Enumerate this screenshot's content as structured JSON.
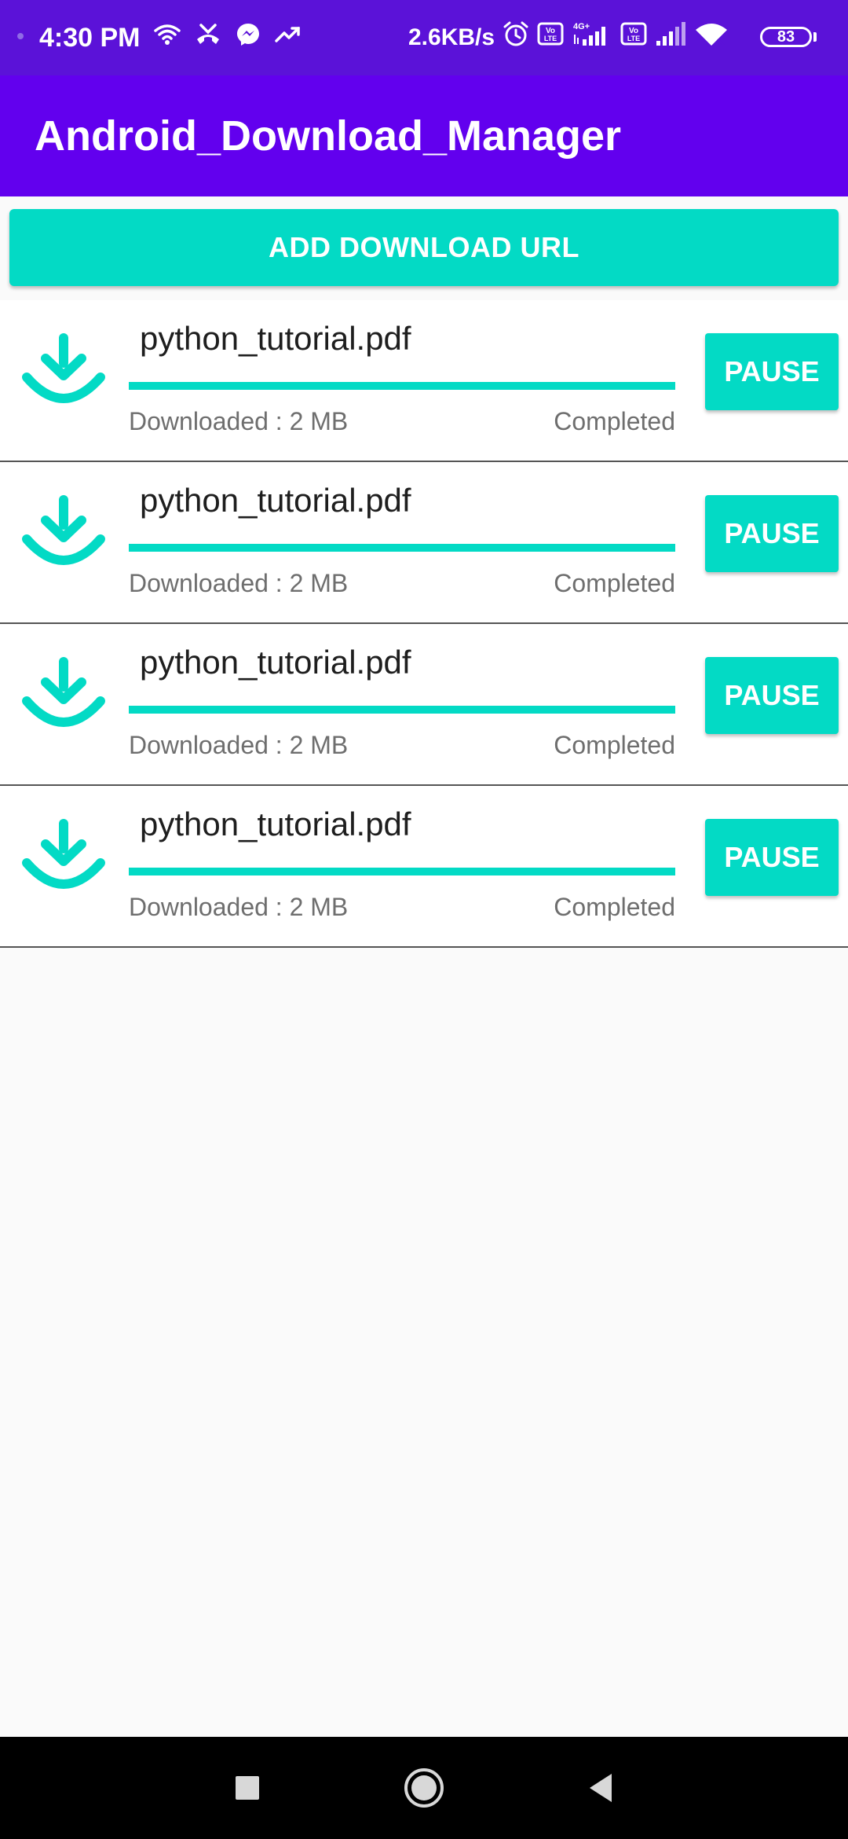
{
  "status_bar": {
    "time": "4:30 PM",
    "net_speed": "2.6KB/s",
    "battery": "83",
    "volte_label_1": "Vo\nLTE",
    "volte_label_2": "Vo\nLTE",
    "network_type": "4G+",
    "icons": [
      "wifi-icon",
      "missed-call-icon",
      "messenger-icon",
      "trending-icon",
      "alarm-icon",
      "volte-icon",
      "signal-icon",
      "volte-icon",
      "signal-icon",
      "wifi-icon",
      "battery-icon"
    ]
  },
  "app_bar": {
    "title": "Android_Download_Manager"
  },
  "add_button": {
    "label": "ADD DOWNLOAD URL"
  },
  "downloads": [
    {
      "file_name": "python_tutorial.pdf",
      "downloaded": "Downloaded : 2 MB",
      "status": "Completed",
      "progress": 1.0,
      "action_label": "PAUSE",
      "icon": "download-icon"
    },
    {
      "file_name": "python_tutorial.pdf",
      "downloaded": "Downloaded : 2 MB",
      "status": "Completed",
      "progress": 1.0,
      "action_label": "PAUSE",
      "icon": "download-icon"
    },
    {
      "file_name": "python_tutorial.pdf",
      "downloaded": "Downloaded : 2 MB",
      "status": "Completed",
      "progress": 1.0,
      "action_label": "PAUSE",
      "icon": "download-icon"
    },
    {
      "file_name": "python_tutorial.pdf",
      "downloaded": "Downloaded : 2 MB",
      "status": "Completed",
      "progress": 1.0,
      "action_label": "PAUSE",
      "icon": "download-icon"
    }
  ],
  "nav_bar": {
    "icons": [
      "recents-square-icon",
      "home-circle-icon",
      "back-triangle-icon"
    ]
  },
  "colors": {
    "status_bar": "#5b12d8",
    "app_bar": "#6200ee",
    "accent": "#03dac5",
    "background": "#fafafa",
    "nav_bar": "#000000"
  }
}
